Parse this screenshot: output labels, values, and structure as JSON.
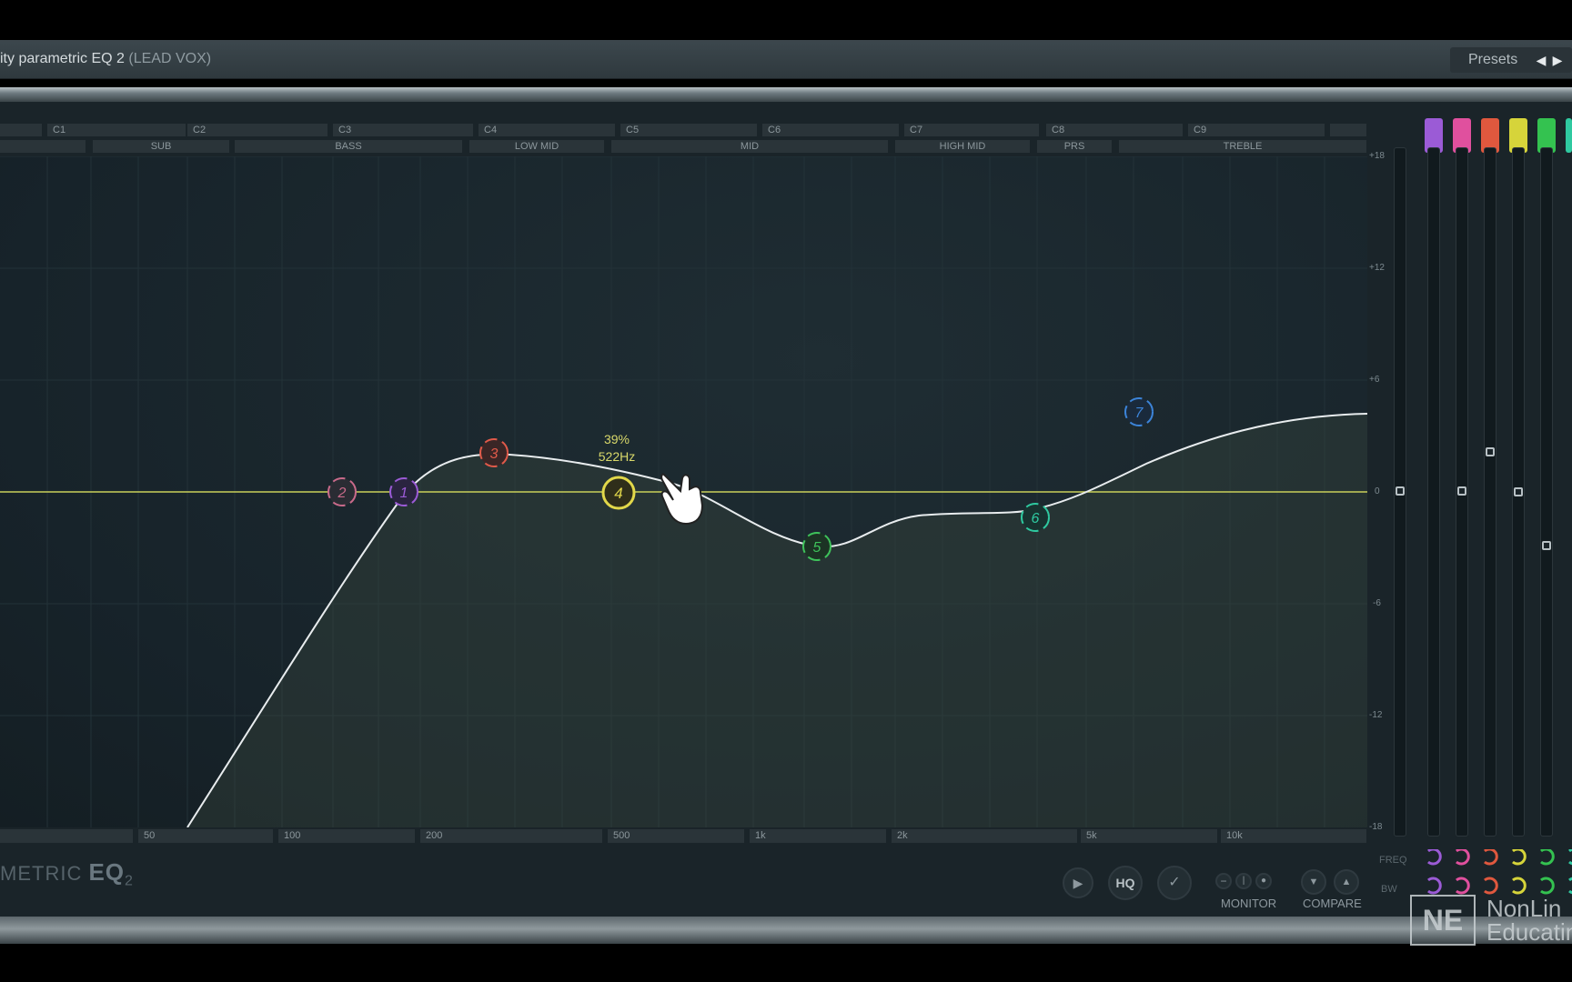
{
  "window": {
    "title": "ity parametric EQ 2",
    "title_track": "(LEAD VOX)",
    "presets_label": "Presets"
  },
  "octaves": [
    "C1",
    "C2",
    "C3",
    "C4",
    "C5",
    "C6",
    "C7",
    "C8",
    "C9"
  ],
  "regions": [
    "SUB",
    "BASS",
    "LOW MID",
    "MID",
    "HIGH MID",
    "PRS",
    "TREBLE"
  ],
  "y_ticks": [
    "+18",
    "+12",
    "+6",
    "0",
    "-6",
    "-12",
    "-18"
  ],
  "x_ticks": [
    "50",
    "100",
    "200",
    "500",
    "1k",
    "2k",
    "5k",
    "10k"
  ],
  "bands": [
    {
      "num": "1",
      "color": "#9b5bd6"
    },
    {
      "num": "2",
      "color": "#c86a8a"
    },
    {
      "num": "3",
      "color": "#e05a4a"
    },
    {
      "num": "4",
      "color": "#e2d84a"
    },
    {
      "num": "5",
      "color": "#3ec25a"
    },
    {
      "num": "6",
      "color": "#2fc9a0"
    },
    {
      "num": "7",
      "color": "#3c84d8"
    }
  ],
  "tooltip": {
    "percent": "39%",
    "freq": "522Hz"
  },
  "mixer_tab_colors": [
    "#9b5bd6",
    "#e0509e",
    "#e0583e",
    "#d6d43a",
    "#34c250",
    "#2fc9a0"
  ],
  "controls": {
    "freq_label": "FREQ",
    "bw_label": "BW",
    "hq_label": "HQ",
    "monitor_label": "MONITOR",
    "compare_label": "COMPARE"
  },
  "logo": {
    "prefix": "METRIC",
    "eq": "EQ",
    "num": "2"
  },
  "watermark": {
    "mark": "NE",
    "line1": "NonLin",
    "line2": "Educating"
  }
}
